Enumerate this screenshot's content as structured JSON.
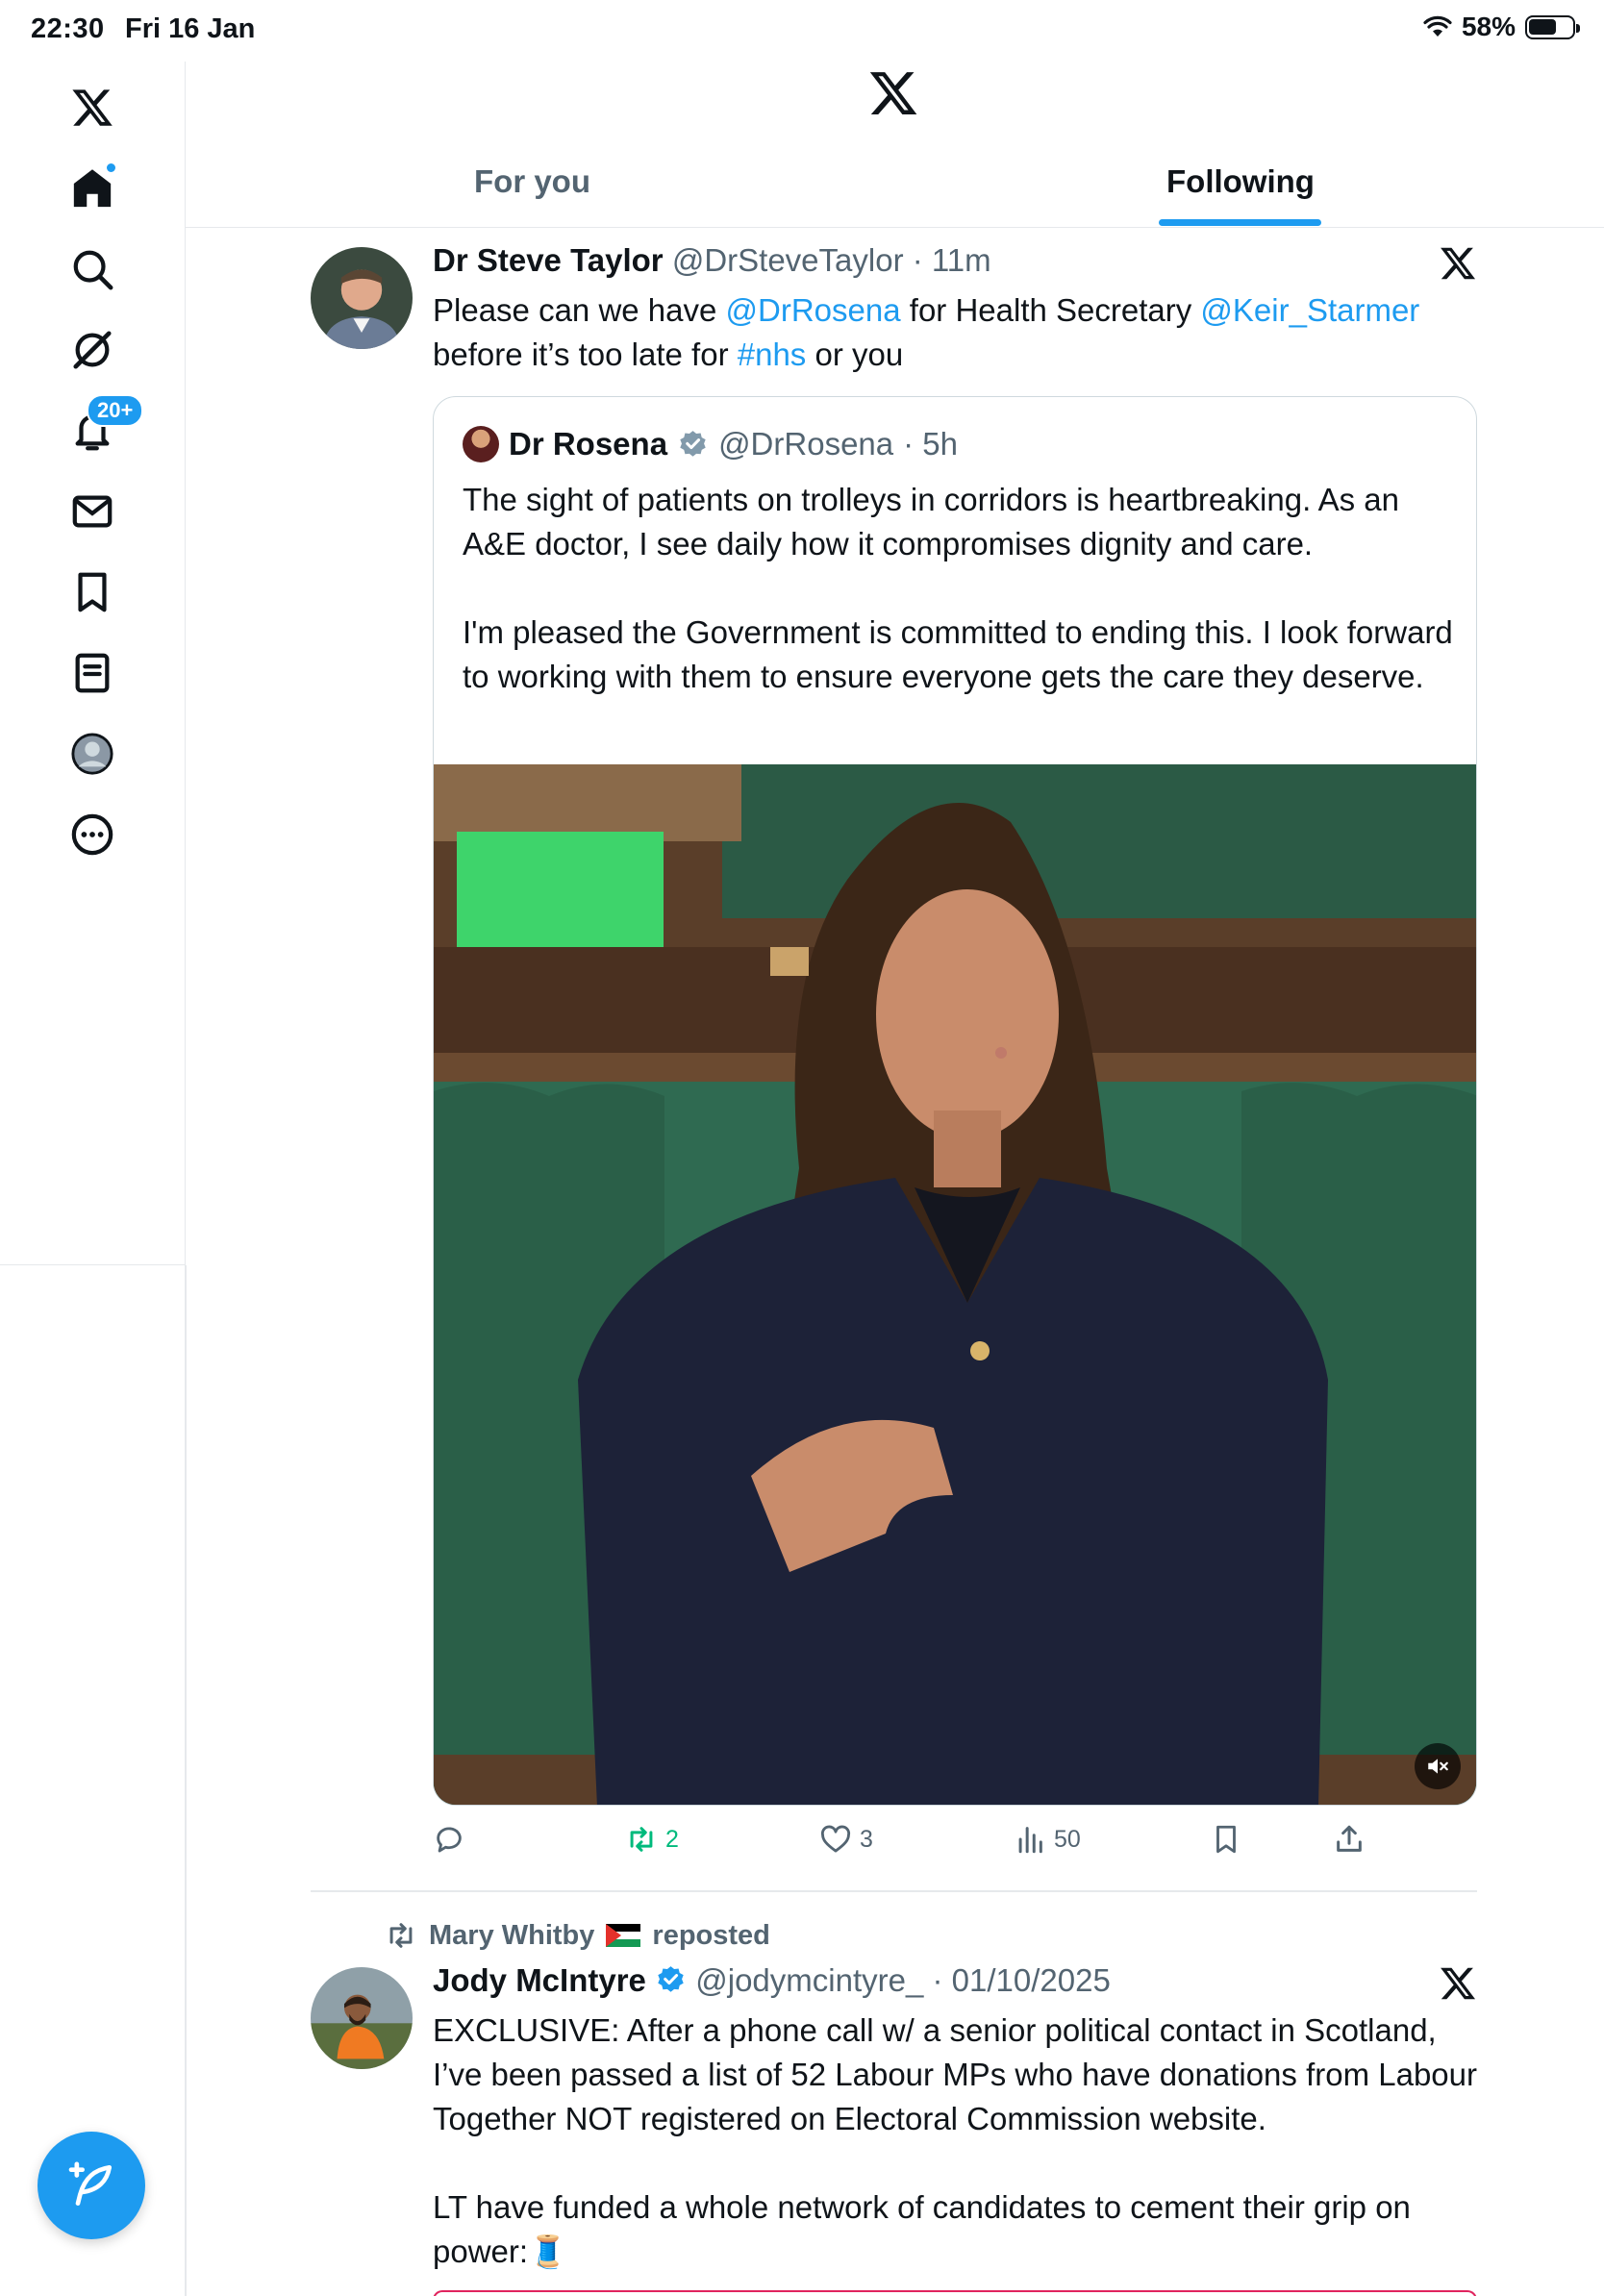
{
  "status_bar": {
    "time": "22:30",
    "date": "Fri 16 Jan",
    "battery": "58%"
  },
  "sidebar": {
    "items": [
      {
        "name": "home",
        "icon": "home-icon"
      },
      {
        "name": "explore",
        "icon": "search-icon"
      },
      {
        "name": "grok",
        "icon": "grok-icon"
      },
      {
        "name": "notifications",
        "icon": "bell-icon",
        "badge": "20+"
      },
      {
        "name": "messages",
        "icon": "envelope-icon"
      },
      {
        "name": "bookmarks",
        "icon": "bookmark-icon"
      },
      {
        "name": "lists",
        "icon": "list-icon"
      },
      {
        "name": "profile",
        "icon": "avatar-icon"
      },
      {
        "name": "more",
        "icon": "more-icon"
      }
    ]
  },
  "header": {
    "tabs": [
      {
        "label": "For you",
        "active": false
      },
      {
        "label": "Following",
        "active": true
      }
    ]
  },
  "tweet1": {
    "name": "Dr Steve Taylor",
    "handle": "@DrSteveTaylor",
    "time": "· 11m",
    "body": {
      "t1": "Please can we have ",
      "m1": "@DrRosena",
      "t2": " for Health Secretary ",
      "m2": "@Keir_Starmer",
      "t3": "before it’s too late for ",
      "h1": "#nhs",
      "t4": " or you"
    },
    "quote": {
      "name": "Dr Rosena",
      "handle": "@DrRosena",
      "time": "· 5h",
      "p1": "The sight of patients on trolleys in corridors is heartbreaking. As an A&E doctor, I see daily how it compromises dignity and care.",
      "p2": "I'm pleased the Government is committed to ending this. I look forward to working with them to ensure everyone gets the care they deserve."
    },
    "actions": {
      "reposts": "2",
      "likes": "3",
      "views": "50"
    }
  },
  "tweet2": {
    "reposted_by": "Mary Whitby",
    "reposted_label": "reposted",
    "name": "Jody McIntyre",
    "handle": "@jodymcintyre_",
    "time": "· 01/10/2025",
    "p1": "EXCLUSIVE: After a phone call w/ a senior political contact in Scotland, I’ve been passed a list of 52 Labour MPs who have donations from Labour Together NOT registered on Electoral Commission website.",
    "p2": "LT have funded a whole network of candidates to cement their grip on power:",
    "emoji": "🧵"
  },
  "colors": {
    "accent": "#1d9bf0",
    "repost_green": "#00ba7c",
    "muted": "#536471"
  }
}
